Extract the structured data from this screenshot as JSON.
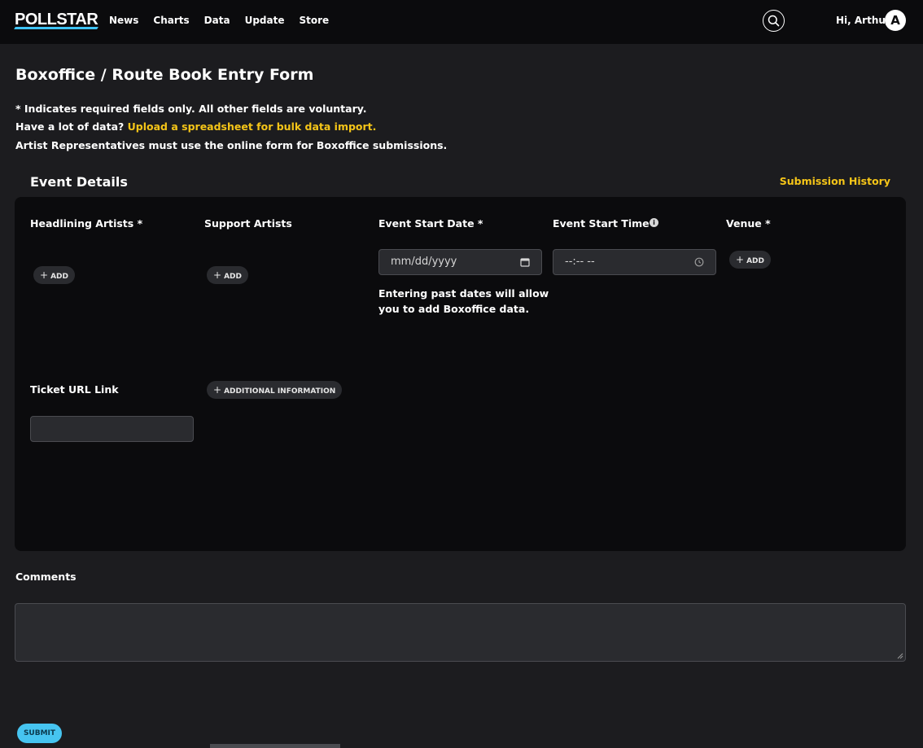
{
  "header": {
    "logo_text": "POLLSTAR",
    "nav": [
      "News",
      "Charts",
      "Data",
      "Update",
      "Store"
    ],
    "greeting": "Hi, Arthur",
    "avatar_initial": "A"
  },
  "page": {
    "title": "Boxoffice / Route Book Entry Form",
    "required_note": "* Indicates required fields only. All other fields are voluntary.",
    "bulk_prefix": "Have a lot of data?",
    "bulk_link": "Upload a spreadsheet for bulk data import.",
    "artist_rep_note": "Artist Representatives must use the online form for Boxoffice submissions."
  },
  "event_details": {
    "title": "Event Details",
    "history_link": "Submission History",
    "headlining_label": "Headlining Artists  *",
    "support_label": "Support Artists",
    "start_date_label": "Event Start Date *",
    "start_time_label": "Event Start Time *",
    "venue_label": "Venue *",
    "add_label": "ADD",
    "date_placeholder": "mm/dd/yyyy",
    "time_placeholder": "--:-- --",
    "date_helper": "Entering past dates will allow you to add Boxoffice data.",
    "ticket_url_label": "Ticket URL Link",
    "ticket_url_value": "",
    "additional_info_label": "ADDITIONAL INFORMATION",
    "info_icon_glyph": "i"
  },
  "comments": {
    "label": "Comments",
    "value": ""
  },
  "submit_label": "SUBMIT",
  "colors": {
    "accent_yellow": "#f5c518",
    "accent_blue": "#46c4f0",
    "background": "#1c1c1f",
    "panel": "#0b0b0d"
  },
  "icons": {
    "search": "search-icon",
    "calendar": "calendar-icon",
    "clock": "clock-icon",
    "info": "info-icon",
    "plus": "plus-icon"
  }
}
